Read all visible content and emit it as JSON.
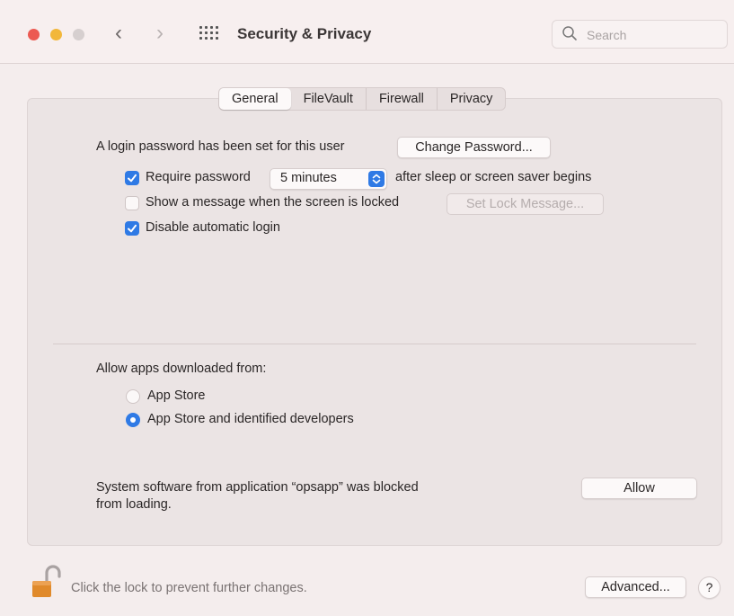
{
  "window": {
    "title": "Security & Privacy",
    "search_placeholder": "Search"
  },
  "tabs": [
    {
      "label": "General",
      "active": true
    },
    {
      "label": "FileVault",
      "active": false
    },
    {
      "label": "Firewall",
      "active": false
    },
    {
      "label": "Privacy",
      "active": false
    }
  ],
  "general": {
    "login_password_text": "A login password has been set for this user",
    "change_password_label": "Change Password...",
    "require_password": {
      "checked": true,
      "label": "Require password",
      "delay": "5 minutes",
      "suffix": "after sleep or screen saver begins"
    },
    "show_message": {
      "checked": false,
      "label": "Show a message when the screen is locked",
      "button": "Set Lock Message..."
    },
    "disable_auto_login": {
      "checked": true,
      "label": "Disable automatic login"
    }
  },
  "downloads": {
    "heading": "Allow apps downloaded from:",
    "options": [
      {
        "label": "App Store",
        "selected": false
      },
      {
        "label": "App Store and identified developers",
        "selected": true
      }
    ]
  },
  "blocked": {
    "line1": "System software from application “opsapp” was blocked",
    "line2": "from loading.",
    "allow_label": "Allow"
  },
  "footer": {
    "lock_text": "Click the lock to prevent further changes.",
    "advanced_label": "Advanced...",
    "help_label": "?"
  },
  "colors": {
    "accent": "#2f7ae5",
    "close": "#ec5a52",
    "minimize": "#f2b73a",
    "lock": "#e08a2b"
  }
}
